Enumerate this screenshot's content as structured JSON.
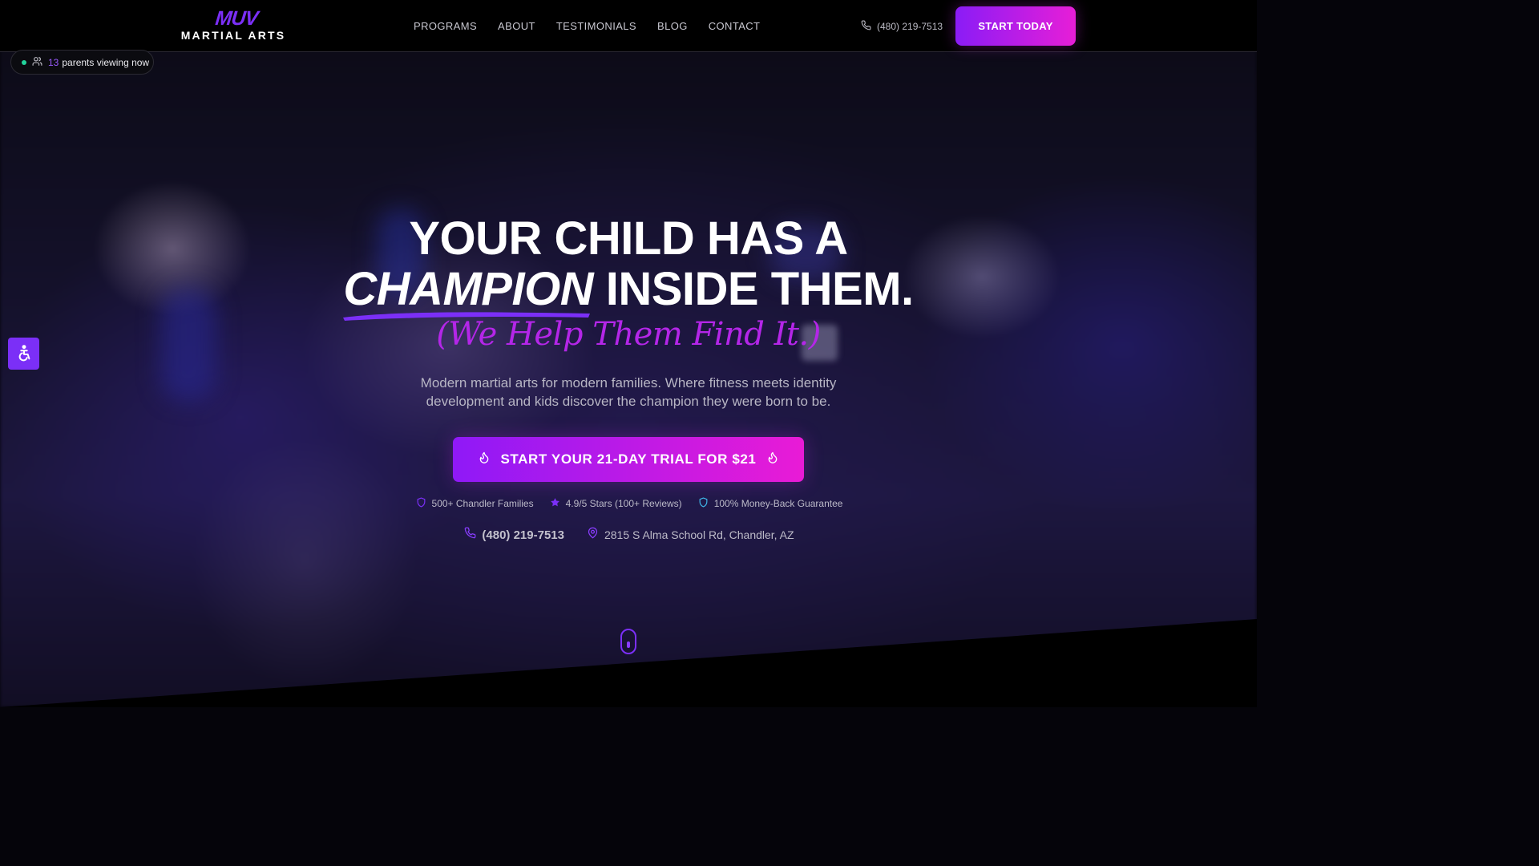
{
  "nav": {
    "logo_mark": "MUV",
    "logo_text": "MARTIAL ARTS",
    "links": [
      "PROGRAMS",
      "ABOUT",
      "TESTIMONIALS",
      "BLOG",
      "CONTACT"
    ],
    "phone": "(480) 219-7513",
    "cta": "START TODAY"
  },
  "viewers": {
    "count": "13",
    "label": "parents viewing now"
  },
  "hero": {
    "line1": "YOUR CHILD HAS A",
    "highlight": "CHAMPION",
    "line2_rest": "INSIDE THEM.",
    "tagline": "(We Help Them Find It.)",
    "subtext": "Modern martial arts for modern families. Where fitness meets identity development and kids discover the champion they were born to be.",
    "cta": "START YOUR 21-DAY TRIAL FOR $21",
    "trust": [
      {
        "icon": "shield-icon",
        "text": "500+ Chandler Families"
      },
      {
        "icon": "star-icon",
        "text": "4.9/5 Stars (100+ Reviews)"
      },
      {
        "icon": "shield-check-icon",
        "text": "100% Money-Back Guarantee"
      }
    ],
    "phone": "(480) 219-7513",
    "address": "2815 S Alma School Rd, Chandler, AZ"
  },
  "colors": {
    "accent_purple": "#7b2ff7",
    "accent_pink": "#e71ed7",
    "tagline": "#b426e8",
    "live_dot": "#22d39b",
    "guarantee_icon": "#3fb6e8"
  }
}
